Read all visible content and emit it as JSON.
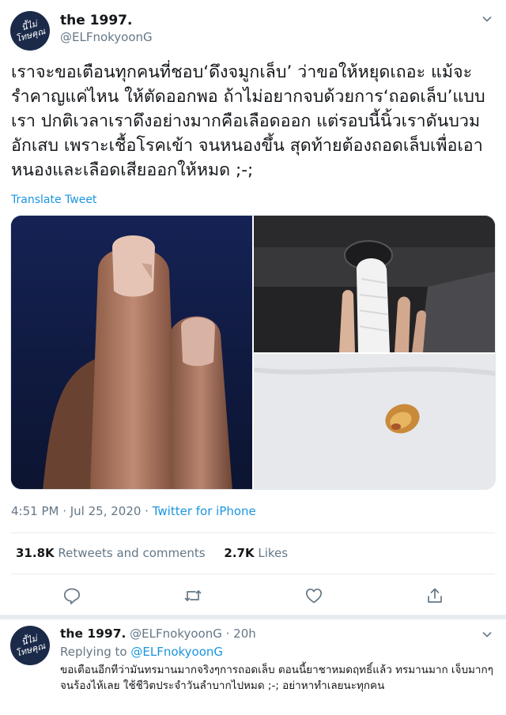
{
  "tweet": {
    "display_name": "the 1997.",
    "handle": "@ELFnokyoonG",
    "avatar_text_line1": "นี้ไม่",
    "avatar_text_line2": "โทษคุณ",
    "text": "เราจะขอเตือนทุกคนที่ชอบ‘ดึงจมูกเล็บ’ ว่าขอให้หยุดเถอะ แม้จะรำคาญแค่ไหน ให้ตัดออกพอ ถ้าไม่อยากจบด้วยการ‘ถอดเล็บ’แบบเรา ปกติเวลาเราดึงอย่างมากคือเลือดออก แต่รอบนี้นิ้วเราดันบวมอักเสบ เพราะเชื้อโรคเข้า จนหนองขึ้น สุดท้ายต้องถอดเล็บเพื่อเอาหนองและเลือดเสียออกให้หมด ;-;",
    "translate_label": "Translate Tweet",
    "time": "4:51 PM · Jul 25, 2020 · ",
    "source": "Twitter for iPhone",
    "retweets_count": "31.8K",
    "retweets_label": "Retweets and comments",
    "likes_count": "2.7K",
    "likes_label": "Likes"
  },
  "reply": {
    "display_name": "the 1997.",
    "handle": "@ELFnokyoonG",
    "age": "· 20h",
    "replying_label": "Replying to",
    "replying_handle": "@ELFnokyoonG",
    "text": "ขอเตือนอีกทีว่ามันทรมานมากจริงๆการถอดเล็บ ตอนนี้ยาชาหมดฤทธิ์แล้ว ทรมานมาก เจ็บมากๆจนร้องไห้เลย ใช้ชีวิตประจำวันลำบากไปหมด ;-; อย่าหาทำเลยนะทุกคน"
  },
  "colors": {
    "link": "#1b95e0",
    "muted": "#657786",
    "text": "#14171a"
  },
  "icons": [
    "chevron-down-icon",
    "reply-icon",
    "retweet-icon",
    "like-icon",
    "share-icon"
  ]
}
